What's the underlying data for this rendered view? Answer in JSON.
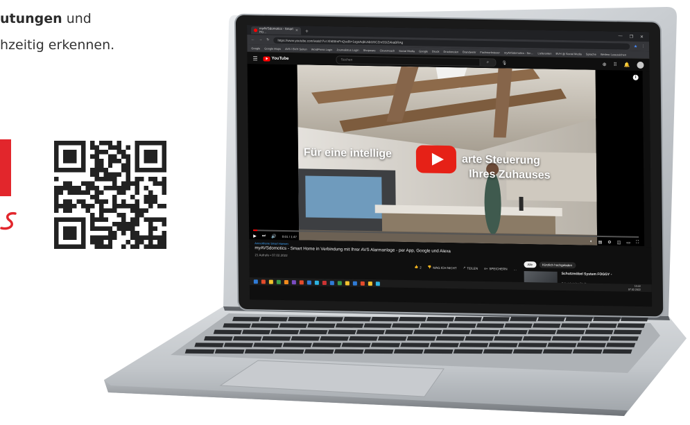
{
  "intro": {
    "line1_bold": "utungen",
    "line1_rest": " und",
    "line2": "hzeitig erkennen."
  },
  "browser": {
    "tab_title": "myAVSdomotics - Smart Ho…",
    "url": "https://www.youtube.com/watch?v=Xh65fmPnQsc8t=1sgsAqbUsbGSCZmSSIZAkaBRAg",
    "bookmarks": [
      "Google",
      "Google Maps",
      "AVS / BVH Seiten",
      "WordPress Login",
      "Journalistus Login",
      "Shopware",
      "Cleverreach",
      "Social Media",
      "Google",
      "Druck",
      "Druckereien",
      "Brandwehr",
      "Fachwerksteuer",
      "myAVSdomotics - Sm…",
      "Lieferanten",
      "BVH @ Social Media",
      "Sprache",
      "Weitere Lesezeichen"
    ]
  },
  "youtube": {
    "logo_text": "YouTube",
    "search_placeholder": "Suchen",
    "video": {
      "overlay_line1_a": "Für eine intellige",
      "overlay_line1_b": "arte Steuerung",
      "overlay_line2": "Ihres Zuhauses",
      "time": "0:01 / 1:47",
      "progress": 0.01
    },
    "channel": "Amnorthone Smart Haesen",
    "title": "myAVSdomotics - Smart Home in Verbindung mit Ihrer AVS Alarmanlage - per App, Google und Alexa",
    "meta": "21 Aufrufe • 07.02.2022",
    "actions": {
      "likes": "2",
      "dislike": "MAG ICH NICHT",
      "share": "TEILEN",
      "save": "SPEICHERN",
      "more": "…"
    },
    "chips": [
      "Alle",
      "Kürzlich hochgeladen"
    ],
    "recommendation": {
      "title": "Schutzmöbel System FOGGY -",
      "subtitle": "Schutzkatalog Stadt"
    }
  },
  "taskbar": {
    "time": "13:22",
    "date": "07.02.2022"
  },
  "colors": {
    "brand_red": "#e2262c",
    "youtube_red": "#ff0000",
    "yt_dark": "#0f0f0f"
  }
}
